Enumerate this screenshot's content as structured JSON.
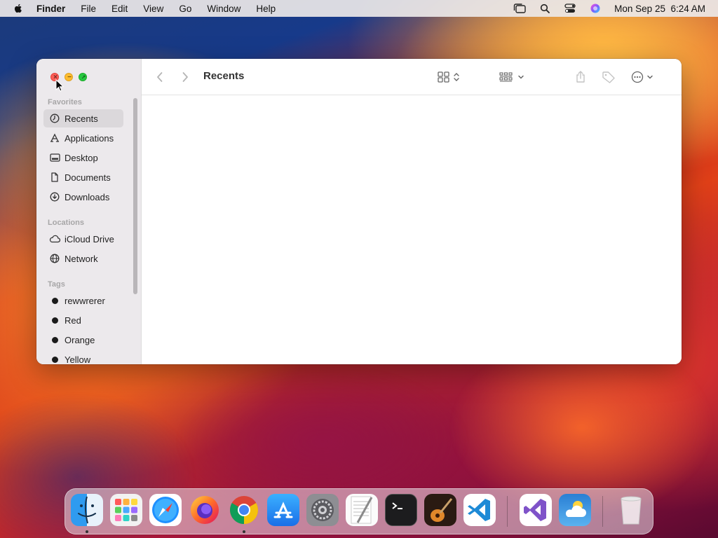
{
  "menubar": {
    "app_name": "Finder",
    "menus": [
      "File",
      "Edit",
      "View",
      "Go",
      "Window",
      "Help"
    ],
    "clock": "Mon Sep 25  6:24 AM"
  },
  "window": {
    "title": "Recents",
    "sidebar": {
      "favorites_label": "Favorites",
      "favorites": [
        {
          "label": "Recents",
          "icon": "clock-icon",
          "selected": true
        },
        {
          "label": "Applications",
          "icon": "applications-icon"
        },
        {
          "label": "Desktop",
          "icon": "desktop-icon"
        },
        {
          "label": "Documents",
          "icon": "document-icon"
        },
        {
          "label": "Downloads",
          "icon": "download-icon"
        }
      ],
      "locations_label": "Locations",
      "locations": [
        {
          "label": "iCloud Drive",
          "icon": "cloud-icon"
        },
        {
          "label": "Network",
          "icon": "globe-icon"
        }
      ],
      "tags_label": "Tags",
      "tags": [
        {
          "label": "rewwrerer",
          "color": "#1a1a1a"
        },
        {
          "label": "Red",
          "color": "#1a1a1a"
        },
        {
          "label": "Orange",
          "color": "#1a1a1a"
        },
        {
          "label": "Yellow",
          "color": "#1a1a1a"
        }
      ]
    }
  },
  "dock": {
    "apps": [
      {
        "name": "Finder",
        "icon": "finder-icon",
        "running": true
      },
      {
        "name": "Launchpad",
        "icon": "launchpad-icon"
      },
      {
        "name": "Safari",
        "icon": "safari-icon"
      },
      {
        "name": "Firefox",
        "icon": "firefox-icon"
      },
      {
        "name": "Chrome",
        "icon": "chrome-icon",
        "running": true
      },
      {
        "name": "App Store",
        "icon": "app-store-icon"
      },
      {
        "name": "System Settings",
        "icon": "settings-icon"
      },
      {
        "name": "TextEdit",
        "icon": "textedit-icon"
      },
      {
        "name": "Terminal",
        "icon": "terminal-icon"
      },
      {
        "name": "GarageBand",
        "icon": "garageband-icon"
      },
      {
        "name": "Visual Studio Code",
        "icon": "vscode-icon"
      },
      {
        "name": "Visual Studio",
        "icon": "visual-studio-icon"
      },
      {
        "name": "Weather",
        "icon": "weather-icon"
      },
      {
        "name": "Trash",
        "icon": "trash-icon"
      }
    ]
  },
  "colors": {
    "close": "#ff5f57",
    "minimize": "#febc2e",
    "zoom": "#28c840",
    "sidebar_bg": "#ece9ec",
    "selection": "#dbd8db"
  }
}
